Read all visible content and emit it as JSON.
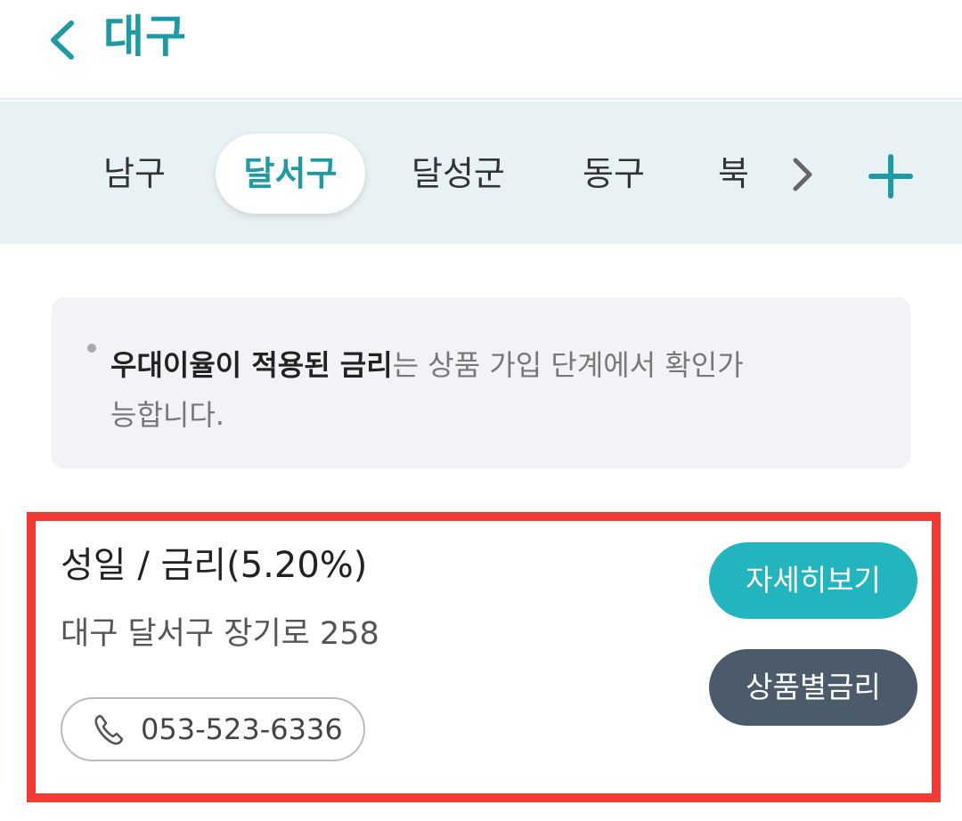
{
  "header": {
    "title": "대구",
    "back_icon": "chevron-left-icon",
    "accent_color": "#1e9aa4"
  },
  "tabs": {
    "items": [
      {
        "label": "남구",
        "active": false
      },
      {
        "label": "달서구",
        "active": true
      },
      {
        "label": "달성군",
        "active": false
      },
      {
        "label": "동구",
        "active": false
      },
      {
        "label": "북",
        "active": false
      }
    ],
    "next_icon": "chevron-right-icon",
    "add_icon": "plus-icon"
  },
  "notice": {
    "strong_text": "우대이율이 적용된 금리",
    "line1_rest": "는 상품 가입 단계에서 확인가",
    "line2": "능합니다."
  },
  "branch": {
    "name": "성일 / 금리(5.20%)",
    "address": "대구 달서구 장기로 258",
    "phone": "053-523-6336",
    "phone_icon": "phone-icon",
    "detail_label": "자세히보기",
    "rate_label": "상품별금리",
    "highlight_color": "#f43a30"
  }
}
